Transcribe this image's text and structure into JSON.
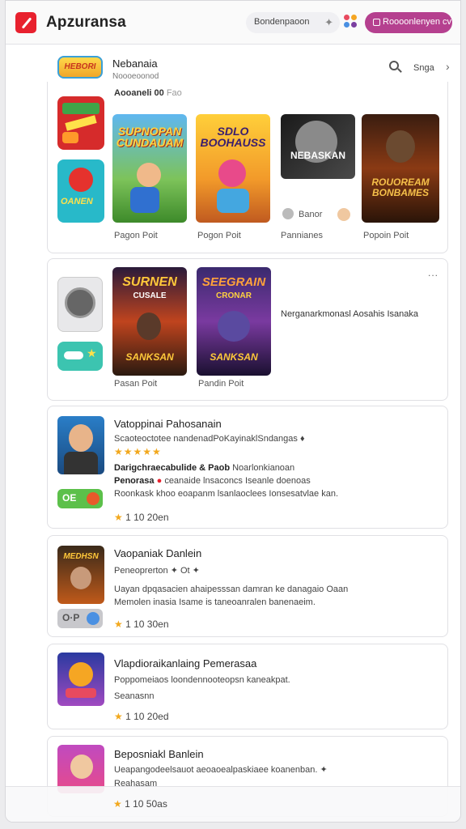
{
  "app": {
    "title": "Apzuransa",
    "search_pill": "Bondenpaoon",
    "action_button": "Roooonlenyen cv"
  },
  "header": {
    "badge_text": "HEBORI",
    "title": "Nebanaia",
    "subtitle": "Noooeoonod",
    "search_label": "Snga"
  },
  "section1": {
    "heading": "Aooaneli 00",
    "heading_meta": "Fao",
    "games": [
      {
        "label": "Pagon Poit",
        "art": "SUPNOPAN CUNDAUAM"
      },
      {
        "label": "Pogon Poit",
        "art": "SDLO BOOHAUSS"
      },
      {
        "label": "Pannianes",
        "art": "NEBASKAN"
      },
      {
        "label": "Popoin Poit",
        "art": "ROUOREAM BONBAMES"
      }
    ],
    "chip_label": "Banor",
    "side_icon2_text": "OANEN"
  },
  "section2": {
    "games": [
      {
        "label": "Pasan Poit",
        "art_top": "SURNEN",
        "art_mid": "CUSALE",
        "art_bottom": "SANKSAN"
      },
      {
        "label": "Pandin Poit",
        "art_top": "SEEGRAIN",
        "art_mid": "CRONAR",
        "art_bottom": "SANKSAN"
      }
    ],
    "description": "Nerganarkmonasl Aosahis Isanaka",
    "more": "..."
  },
  "list": [
    {
      "title": "Vatoppinai Pahosanain",
      "line1": "Scaoteoctotee nandenadPoKayinaklSndangas ♦",
      "stars": "★★★★★",
      "line2_bold": "Darigchraecabulide & Paob",
      "line2_rest": "Noarlonkianoan",
      "line3_bold": "Penorasa",
      "line3_rest": "ceanaide lnsaconcs Iseanle doenoas",
      "line4": "Roonkask khoo eoapanm lsanlaoclees Ionsesatvlae kan.",
      "pill": "OE",
      "rating_value": "1 10 20en"
    },
    {
      "title": "Vaopaniak Danlein",
      "line1": "Peneoprerton ✦ Ot ✦",
      "line2": "Uayan dpqasacien ahaipesssan damran ke danagaio Oaan",
      "line3": "Memolen inasia Isame is taneoanralen banenaeim.",
      "pill": "O·P",
      "rating_value": "1 10 30en",
      "thumb_text": "MEDHSN"
    },
    {
      "title": "Vlapdioraikanlaing Pemerasaa",
      "line1": "Poppomeiaos loondennooteopsn kaneakpat.",
      "line2": "Seanasnn",
      "rating_value": "1 10 20ed"
    },
    {
      "title": "Beposniakl Banlein",
      "line1": "Ueapangodeelsauot aeoaoealpaskiaee koanenban. ✦",
      "line2": "Reahasam",
      "rating_value": "1 10 50as"
    }
  ],
  "colors": {
    "accent": "#b5408f",
    "logo": "#e8212e",
    "star": "#f2a81d"
  }
}
